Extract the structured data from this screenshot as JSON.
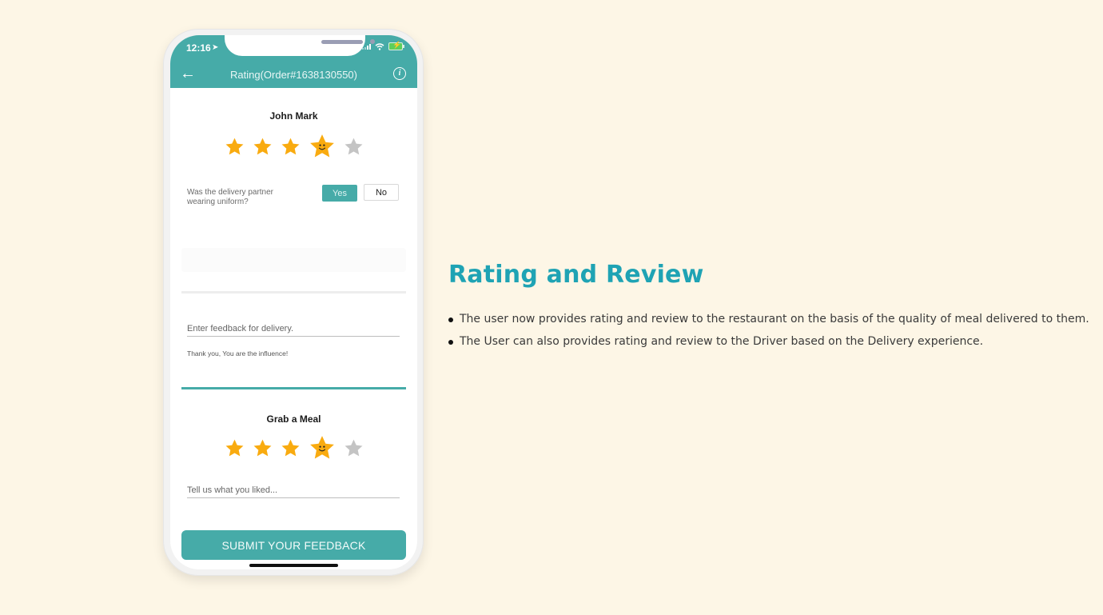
{
  "status_bar": {
    "time": "12:16"
  },
  "nav": {
    "title": "Rating(Order#1638130550)",
    "back_icon": "arrow-left-icon",
    "info_icon": "info-icon",
    "info_glyph": "i"
  },
  "driver": {
    "name": "John Mark",
    "rating": 4,
    "max_rating": 5,
    "question": "Was the delivery partner wearing uniform?",
    "yes_label": "Yes",
    "no_label": "No",
    "selected": "Yes",
    "feedback_placeholder": "Enter feedback for delivery.",
    "feedback_value": "",
    "helper_text": "Thank you, You are the influence!"
  },
  "restaurant": {
    "name": "Grab a Meal",
    "rating": 4,
    "max_rating": 5,
    "feedback_placeholder": "Tell us what you liked...",
    "feedback_value": ""
  },
  "submit_label": "SUBMIT YOUR FEEDBACK",
  "colors": {
    "accent": "#46aba8",
    "star_active": "#f9ab10",
    "star_inactive": "#c4c4c4",
    "heading": "#1fa3b4",
    "background": "#fdf6e6"
  },
  "description": {
    "title": "Rating and Review",
    "bullets": [
      "The user now provides rating and review to the restaurant on the basis of the quality of meal delivered to them.",
      "The User can also provides rating and review to the Driver based on the Delivery experience."
    ]
  }
}
